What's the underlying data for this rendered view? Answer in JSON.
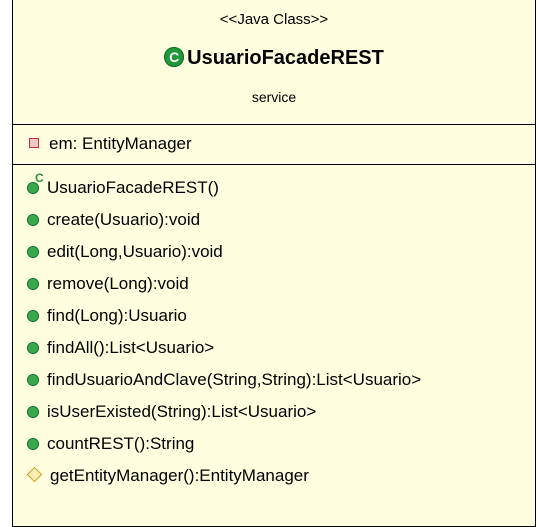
{
  "class_box": {
    "stereotype": "<<Java Class>>",
    "name": "UsuarioFacadeREST",
    "class_icon": "C",
    "package": "service",
    "fields": [
      {
        "visibility": "private",
        "text": "em: EntityManager"
      }
    ],
    "methods": [
      {
        "visibility": "constructor",
        "text": "UsuarioFacadeREST()"
      },
      {
        "visibility": "public",
        "text": "create(Usuario):void"
      },
      {
        "visibility": "public",
        "text": "edit(Long,Usuario):void"
      },
      {
        "visibility": "public",
        "text": "remove(Long):void"
      },
      {
        "visibility": "public",
        "text": "find(Long):Usuario"
      },
      {
        "visibility": "public",
        "text": "findAll():List<Usuario>"
      },
      {
        "visibility": "public",
        "text": "findUsuarioAndClave(String,String):List<Usuario>"
      },
      {
        "visibility": "public",
        "text": "isUserExisted(String):List<Usuario>"
      },
      {
        "visibility": "public",
        "text": "countREST():String"
      },
      {
        "visibility": "protected",
        "text": "getEntityManager():EntityManager"
      }
    ]
  },
  "colors": {
    "background": "#ffffe0",
    "public_icon": "#37a84b",
    "private_icon": "#c8283c",
    "protected_icon": "#c8a028"
  }
}
